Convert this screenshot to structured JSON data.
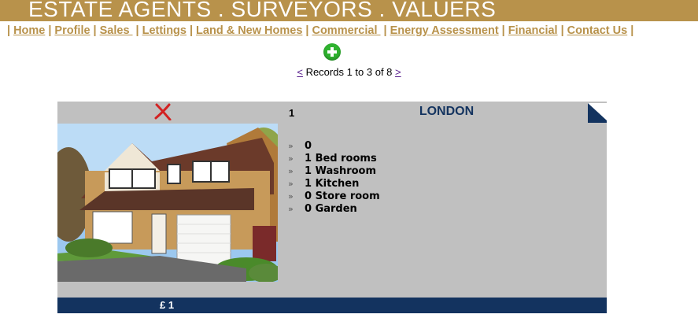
{
  "banner": {
    "text": "ESTATE AGENTS . SURVEYORS .  VALUERS"
  },
  "nav": {
    "items": [
      {
        "label": "Home",
        "name": "nav-home"
      },
      {
        "label": "Profile",
        "name": "nav-profile"
      },
      {
        "label": "Sales ",
        "name": "nav-sales"
      },
      {
        "label": "Lettings",
        "name": "nav-lettings"
      },
      {
        "label": "Land & New Homes",
        "name": "nav-land-new-homes"
      },
      {
        "label": "Commercial ",
        "name": "nav-commercial"
      },
      {
        "label": "Energy Assessment",
        "name": "nav-energy-assessment"
      },
      {
        "label": "Financial",
        "name": "nav-financial"
      },
      {
        "label": "Contact Us",
        "name": "nav-contact-us"
      }
    ]
  },
  "pager": {
    "prev": "<",
    "text": " Records 1 to 3 of 8 ",
    "next": ">"
  },
  "listing": {
    "number": "1",
    "city": "LONDON",
    "features": [
      "0",
      "1 Bed rooms",
      "1 Washroom",
      "1 Kitchen",
      "0 Store room",
      "0 Garden"
    ],
    "bullet": "»",
    "price": "£ 1"
  },
  "colors": {
    "brand_gold": "#b8924b",
    "navy": "#13335f",
    "card_grey": "#c0c0c0",
    "add_green": "#2fb32f"
  },
  "icons": {
    "add": "plus-circle-icon",
    "delete": "red-x-icon",
    "corner": "page-corner-icon"
  }
}
